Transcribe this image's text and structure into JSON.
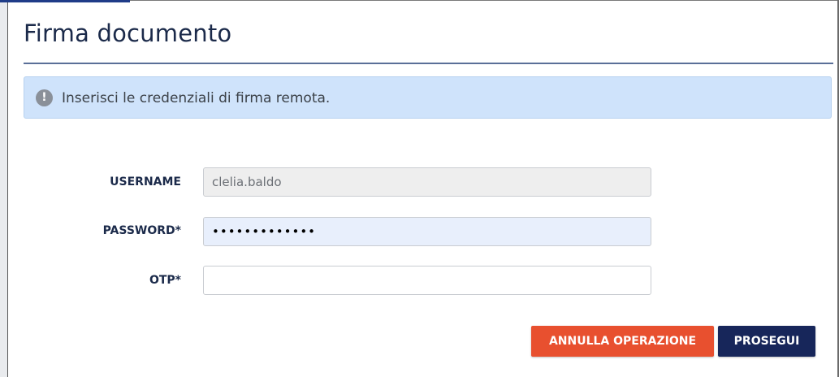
{
  "dialog": {
    "title": "Firma documento"
  },
  "alert": {
    "icon": "exclamation-icon",
    "message": "Inserisci le credenziali di firma remota."
  },
  "form": {
    "username": {
      "label": "USERNAME",
      "value": "clelia.baldo"
    },
    "password": {
      "label": "PASSWORD*",
      "value": "•••••••••••••"
    },
    "otp": {
      "label": "OTP*",
      "value": ""
    }
  },
  "actions": {
    "cancel_label": "ANNULLA OPERAZIONE",
    "continue_label": "PROSEGUI"
  },
  "colors": {
    "cancel_button": "#e8502f",
    "continue_button": "#17265a",
    "alert_background": "#cfe3fb",
    "title": "#1b2a4a"
  }
}
